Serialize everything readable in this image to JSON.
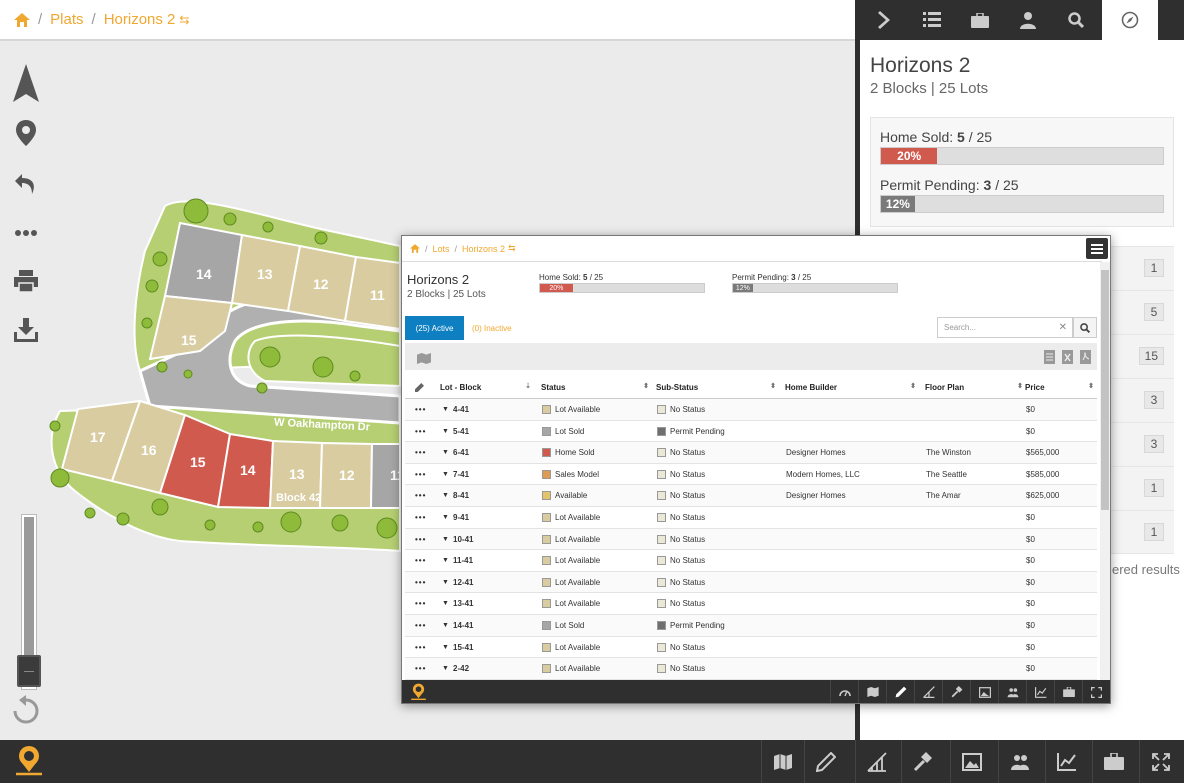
{
  "breadcrumb": {
    "plats": "Plats",
    "current": "Horizons 2"
  },
  "map": {
    "street": "W Oakhampton Dr",
    "block_label": "Block 42",
    "lots_upper": [
      "14",
      "13",
      "12",
      "11",
      "15"
    ],
    "lots_lower": [
      "17",
      "16",
      "15",
      "14",
      "13",
      "12",
      "11"
    ]
  },
  "right_panel": {
    "title": "Horizons 2",
    "subtitle": "2 Blocks | 25 Lots",
    "home_sold": {
      "label": "Home Sold:",
      "value": "5",
      "total": "/ 25",
      "percent": "20%",
      "fill": 0.2,
      "color": "#d05a4e"
    },
    "permit_pending": {
      "label": "Permit Pending:",
      "value": "3",
      "total": "/ 25",
      "percent": "12%",
      "fill": 0.12,
      "color": "#7a7a7a"
    },
    "counts": [
      "1",
      "5",
      "15",
      "3",
      "3",
      "1",
      "1"
    ],
    "filtered_text": "ered results"
  },
  "lots_window": {
    "crumb": {
      "lots": "Lots",
      "current": "Horizons 2"
    },
    "title": "Horizons 2",
    "subtitle": "2 Blocks | 25 Lots",
    "home_sold": {
      "label": "Home Sold:",
      "value": "5",
      "total": "/ 25",
      "percent": "20%",
      "fill": 0.2
    },
    "permit_pending": {
      "label": "Permit Pending:",
      "value": "3",
      "total": "/ 25",
      "percent": "12%",
      "fill": 0.12
    },
    "tab_active": "(25) Active",
    "tab_inactive": "(0) Inactive",
    "search_placeholder": "Search...",
    "columns": {
      "lot_block": "Lot - Block",
      "status": "Status",
      "sub_status": "Sub-Status",
      "home_builder": "Home Builder",
      "floor_plan": "Floor Plan",
      "price": "Price"
    },
    "rows": [
      {
        "lot": "4-41",
        "status": "Lot Available",
        "status_color": "#d8cca0",
        "sub": "No Status",
        "sub_color": "#ece8d8",
        "builder": "",
        "plan": "",
        "price": "$0"
      },
      {
        "lot": "5-41",
        "status": "Lot Sold",
        "status_color": "#a6a6a6",
        "sub": "Permit Pending",
        "sub_color": "#6f6f6f",
        "builder": "",
        "plan": "",
        "price": "$0"
      },
      {
        "lot": "6-41",
        "status": "Home Sold",
        "status_color": "#d05a4e",
        "sub": "No Status",
        "sub_color": "#ece8d8",
        "builder": "Designer Homes",
        "plan": "The Winston",
        "price": "$565,000"
      },
      {
        "lot": "7-41",
        "status": "Sales Model",
        "status_color": "#e09b52",
        "sub": "No Status",
        "sub_color": "#ece8d8",
        "builder": "Modern Homes, LLC",
        "plan": "The Seattle",
        "price": "$585,000"
      },
      {
        "lot": "8-41",
        "status": "Available",
        "status_color": "#e3c46a",
        "sub": "No Status",
        "sub_color": "#ece8d8",
        "builder": "Designer Homes",
        "plan": "The Amar",
        "price": "$625,000"
      },
      {
        "lot": "9-41",
        "status": "Lot Available",
        "status_color": "#d8cca0",
        "sub": "No Status",
        "sub_color": "#ece8d8",
        "builder": "",
        "plan": "",
        "price": "$0"
      },
      {
        "lot": "10-41",
        "status": "Lot Available",
        "status_color": "#d8cca0",
        "sub": "No Status",
        "sub_color": "#ece8d8",
        "builder": "",
        "plan": "",
        "price": "$0"
      },
      {
        "lot": "11-41",
        "status": "Lot Available",
        "status_color": "#d8cca0",
        "sub": "No Status",
        "sub_color": "#ece8d8",
        "builder": "",
        "plan": "",
        "price": "$0"
      },
      {
        "lot": "12-41",
        "status": "Lot Available",
        "status_color": "#d8cca0",
        "sub": "No Status",
        "sub_color": "#ece8d8",
        "builder": "",
        "plan": "",
        "price": "$0"
      },
      {
        "lot": "13-41",
        "status": "Lot Available",
        "status_color": "#d8cca0",
        "sub": "No Status",
        "sub_color": "#ece8d8",
        "builder": "",
        "plan": "",
        "price": "$0"
      },
      {
        "lot": "14-41",
        "status": "Lot Sold",
        "status_color": "#a6a6a6",
        "sub": "Permit Pending",
        "sub_color": "#6f6f6f",
        "builder": "",
        "plan": "",
        "price": "$0"
      },
      {
        "lot": "15-41",
        "status": "Lot Available",
        "status_color": "#d8cca0",
        "sub": "No Status",
        "sub_color": "#ece8d8",
        "builder": "",
        "plan": "",
        "price": "$0"
      },
      {
        "lot": "2-42",
        "status": "Lot Available",
        "status_color": "#d8cca0",
        "sub": "No Status",
        "sub_color": "#ece8d8",
        "builder": "",
        "plan": "",
        "price": "$0"
      }
    ]
  },
  "colors": {
    "accent": "#f0a830",
    "active_tab": "#0e7fc1",
    "dark": "#2f2f2f",
    "home_sold": "#d05a4e",
    "lot_available": "#d8cca0",
    "lot_sold": "#a6a6a6",
    "green_space": "#b6cf72"
  },
  "icons": {
    "left_tools": [
      "north-arrow-icon",
      "location-pin-icon",
      "undo-icon",
      "more-dots-icon",
      "print-icon",
      "download-icon",
      "reset-rotate-icon"
    ],
    "right_tabs": [
      "chevron-right-icon",
      "list-icon",
      "briefcase-icon",
      "person-icon",
      "search-icon",
      "compass-icon"
    ],
    "bottom_bar": [
      "map-icon",
      "pencil-ruler-icon",
      "draw-area-icon",
      "hammer-icon",
      "image-icon",
      "people-icon",
      "chart-icon",
      "briefcase-icon",
      "expand-icon"
    ]
  }
}
